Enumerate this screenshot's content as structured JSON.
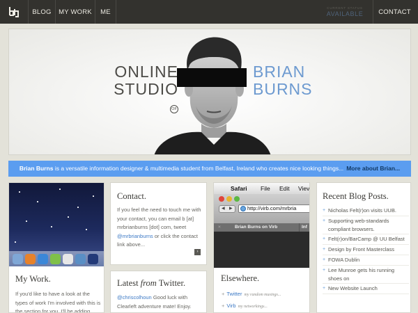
{
  "nav": {
    "items": [
      {
        "label": "BLOG"
      },
      {
        "label": "MY WORK"
      },
      {
        "label": "ME"
      }
    ],
    "status_label": "CURRENT STATUS",
    "status_value": "AVAILABLE",
    "contact_label": "CONTACT"
  },
  "hero": {
    "left_line1": "ONLINE",
    "left_line2": "STUDIO",
    "left_of": "OF",
    "right_line1": "BRIAN",
    "right_line2": "BURNS"
  },
  "banner": {
    "name": "Brian Burns",
    "text": " is a versatile information designer & multimedia student from Belfast, Ireland who creates nice looking things...",
    "more_link": "More about Brian..."
  },
  "work": {
    "title": "My Work.",
    "text": "If you'd like to have a look at the types of work I'm involved with this is the section for you. I'll be adding"
  },
  "contact": {
    "title": "Contact.",
    "text_before": "If you feel the need to touch me with your contact, you can email b [at] mrbrianburns [dot] com, tweet ",
    "link": "@mrbrianburns",
    "text_after": " or click the contact link above...",
    "arrow": "›"
  },
  "twitter": {
    "title_prefix": "Latest ",
    "title_italic": "from",
    "title_suffix": " Twitter.",
    "link": "@chriscolhoun",
    "text": " Good luck with Clearleft adventure mate! Enjoy."
  },
  "browser": {
    "menu_app": "Safari",
    "menu_items": [
      "File",
      "Edit",
      "View"
    ],
    "menu_items_display": [
      "File",
      "Edit",
      "Viev"
    ],
    "url": "http://virb.com/mrbria",
    "tab1": "Brian Burns on Virb",
    "tab2": "Inf"
  },
  "elsewhere": {
    "title": "Elsewhere.",
    "items": [
      {
        "name": "Twitter",
        "note": "my random musings..."
      },
      {
        "name": "Virb",
        "note": "my networkings..."
      },
      {
        "name": "",
        "note": ""
      }
    ]
  },
  "blog": {
    "title": "Recent Blog Posts.",
    "posts": [
      "Nicholas Felt(r)on visits UUB.",
      "Supporting web-standards compliant browsers.",
      "Felt(r)on/BarCamp @ UU Belfast",
      "Design by Front Masterclass",
      "FOWA Dublin",
      "Lee Munroe gets his running shoes on",
      "New Website Launch"
    ]
  },
  "colors": {
    "nav_bg": "#33322e",
    "accent_blue": "#5b9df0",
    "link_blue": "#3c79c5",
    "page_bg": "#e3e2d9"
  }
}
